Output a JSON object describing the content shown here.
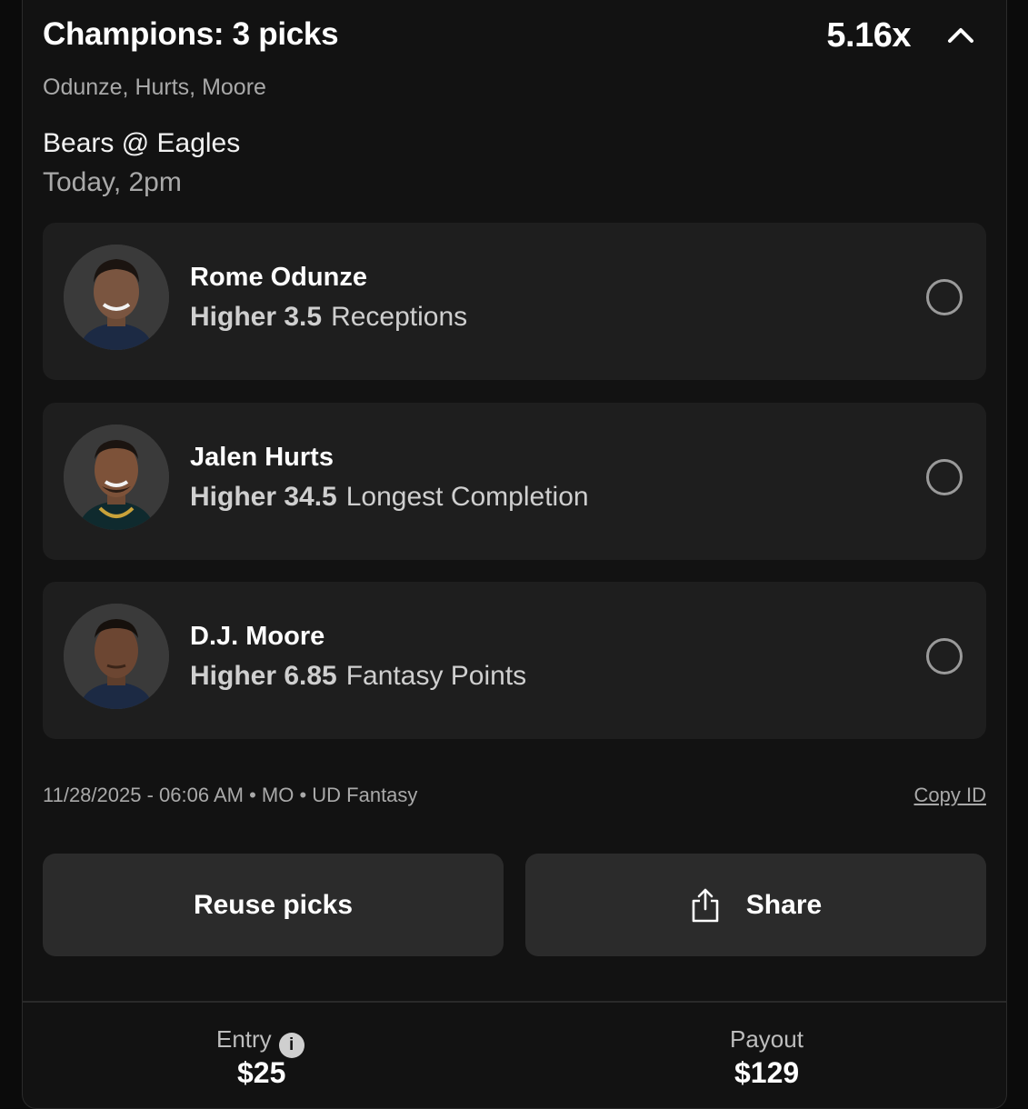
{
  "header": {
    "title": "Champions: 3 picks",
    "multiplier": "5.16x",
    "player_names": "Odunze, Hurts, Moore"
  },
  "game": {
    "matchup": "Bears @ Eagles",
    "time": "Today, 2pm"
  },
  "picks": [
    {
      "name": "Rome Odunze",
      "direction_line": "Higher 3.5",
      "stat": "Receptions"
    },
    {
      "name": "Jalen Hurts",
      "direction_line": "Higher 34.5",
      "stat": "Longest Completion"
    },
    {
      "name": "D.J. Moore",
      "direction_line": "Higher 6.85",
      "stat": "Fantasy Points"
    }
  ],
  "meta": {
    "info": "11/28/2025 - 06:06 AM • MO • UD Fantasy",
    "copy_id": "Copy ID"
  },
  "buttons": {
    "reuse": "Reuse picks",
    "share": "Share"
  },
  "summary": {
    "entry_label": "Entry",
    "entry_value": "$25",
    "payout_label": "Payout",
    "payout_value": "$129"
  }
}
